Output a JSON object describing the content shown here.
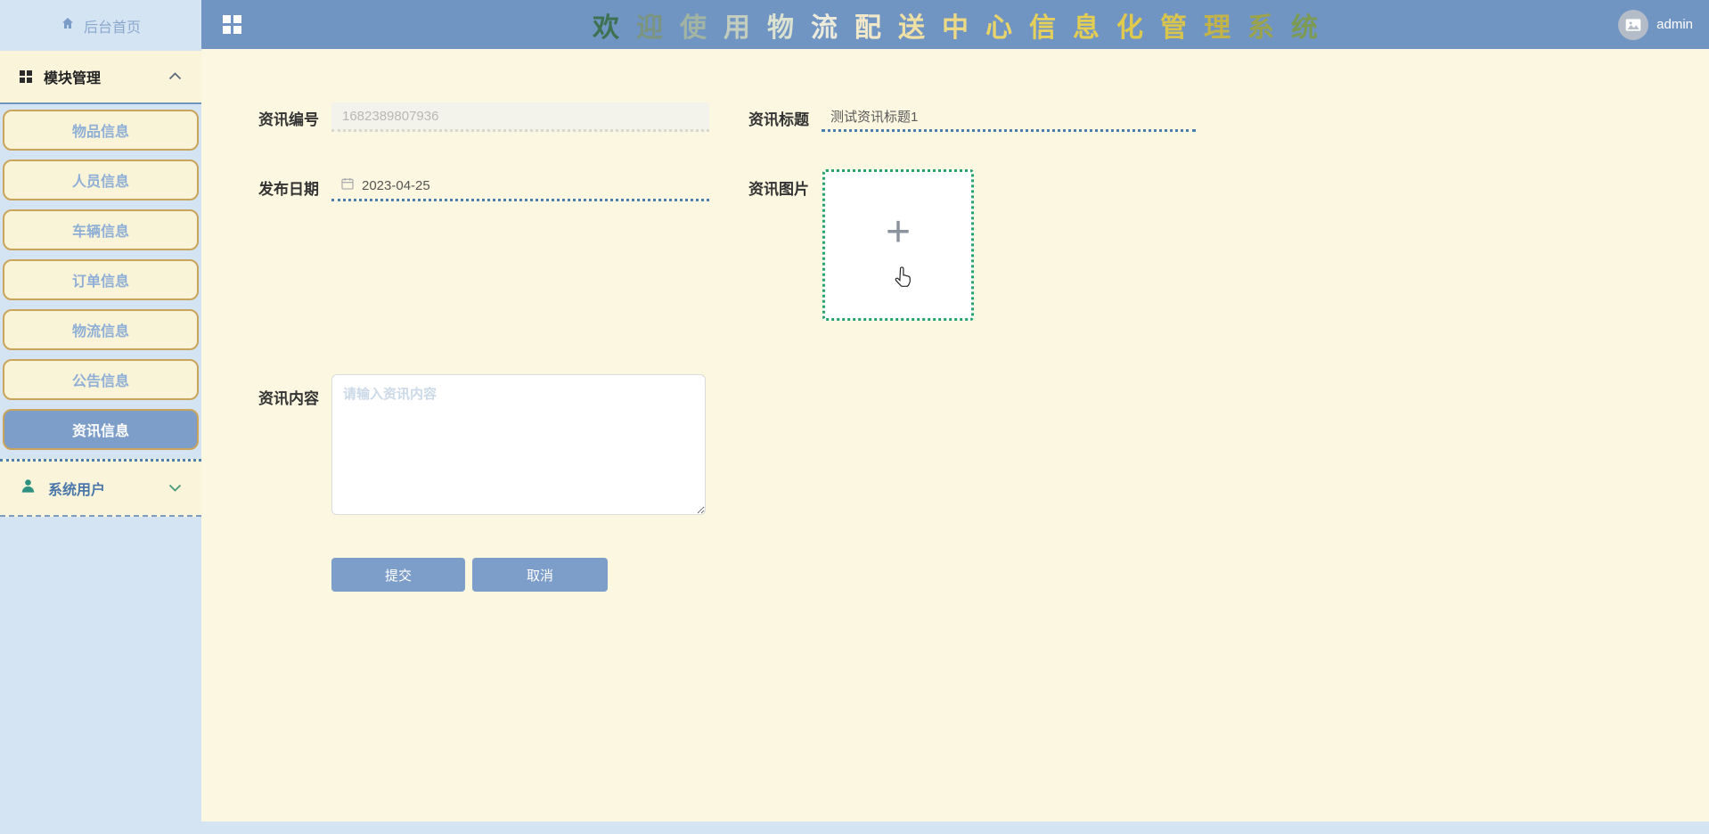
{
  "header": {
    "title": "欢迎使用物流配送中心信息化管理系统",
    "title_chars": [
      "欢",
      "迎",
      "使",
      "用",
      "物",
      "流",
      "配",
      "送",
      "中",
      "心",
      "信",
      "息",
      "化",
      "管",
      "理",
      "系",
      "统"
    ],
    "title_colors": [
      "#3e7152",
      "#7a947f",
      "#a2b4a2",
      "#c2cdbd",
      "#dce2d0",
      "#eceadb",
      "#f0e8c8",
      "#efe0a4",
      "#ecd985",
      "#e8d46a",
      "#e5d05a",
      "#e3cd52",
      "#e0ca4e",
      "#d9c44c",
      "#c2b24a",
      "#9ba44c",
      "#7d9a52"
    ],
    "user": "admin"
  },
  "sidebar": {
    "home_label": "后台首页",
    "module_section": {
      "label": "模块管理",
      "expanded": true,
      "items": [
        {
          "label": "物品信息",
          "active": false
        },
        {
          "label": "人员信息",
          "active": false
        },
        {
          "label": "车辆信息",
          "active": false
        },
        {
          "label": "订单信息",
          "active": false
        },
        {
          "label": "物流信息",
          "active": false
        },
        {
          "label": "公告信息",
          "active": false
        },
        {
          "label": "资讯信息",
          "active": true
        }
      ]
    },
    "user_section": {
      "label": "系统用户",
      "expanded": false
    }
  },
  "form": {
    "info_id": {
      "label": "资讯编号",
      "value": "1682389807936",
      "disabled": true
    },
    "info_title": {
      "label": "资讯标题",
      "value": "测试资讯标题1"
    },
    "publish_date": {
      "label": "发布日期",
      "value": "2023-04-25"
    },
    "info_image": {
      "label": "资讯图片"
    },
    "info_content": {
      "label": "资讯内容",
      "placeholder": "请输入资讯内容"
    },
    "submit_label": "提交",
    "cancel_label": "取消"
  },
  "colors": {
    "header_blue": "#7195c3",
    "active_blue": "#7e9eca",
    "sidebar_blue": "#d5e4f2",
    "content_cream": "#fbf7e0",
    "gold_border": "#c9a45a",
    "dotted_blue": "#4c7fad",
    "upload_green": "#27a268"
  }
}
